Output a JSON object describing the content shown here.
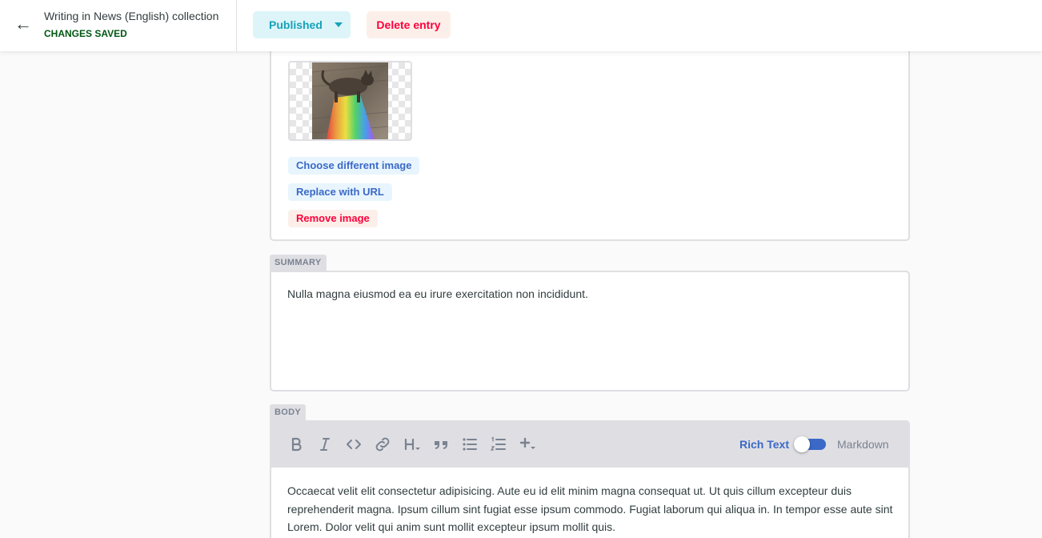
{
  "header": {
    "back_title": "Writing in News (English) collection",
    "save_status": "CHANGES SAVED",
    "publish_label": "Published",
    "delete_label": "Delete entry"
  },
  "image_field": {
    "choose_label": "Choose different image",
    "replace_label": "Replace with URL",
    "remove_label": "Remove image"
  },
  "summary": {
    "label": "SUMMARY",
    "value": "Nulla magna eiusmod ea eu irure exercitation non incididunt."
  },
  "body": {
    "label": "BODY",
    "toolbar_icons": [
      "bold-icon",
      "italic-icon",
      "code-icon",
      "link-icon",
      "heading-icon",
      "quote-icon",
      "bulleted-list-icon",
      "numbered-list-icon",
      "add-component-icon"
    ],
    "mode_rich_text": "Rich Text",
    "mode_markdown": "Markdown",
    "value": "Occaecat velit elit consectetur adipisicing. Aute eu id elit minim magna consequat ut. Ut quis cillum excepteur duis reprehenderit magna. Ipsum cillum sint fugiat esse ipsum commodo. Fugiat laborum qui aliqua in. In tempor esse aute sint Lorem. Dolor velit qui anim sunt mollit excepteur ipsum mollit quis."
  },
  "colors": {
    "accent": "#3a69c7",
    "danger": "#ff003b",
    "success": "#005614",
    "publish": "#17a2b8"
  }
}
